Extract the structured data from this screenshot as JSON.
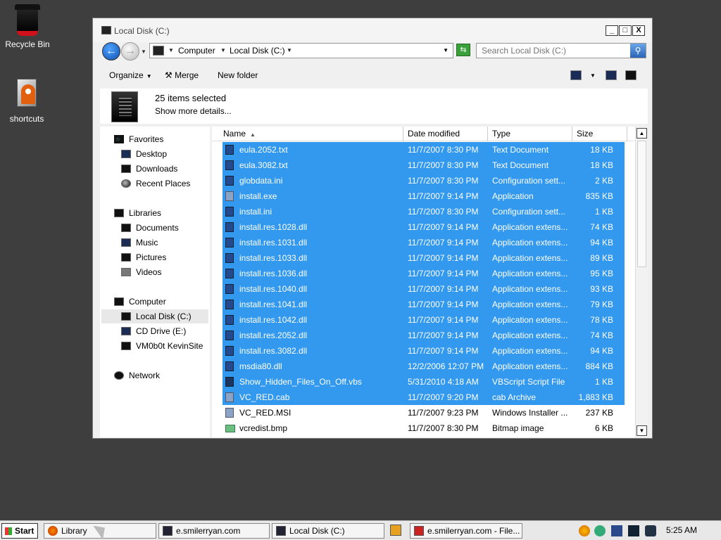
{
  "desktop": {
    "recycle_bin": "Recycle Bin",
    "shortcuts": "shortcuts"
  },
  "window": {
    "title": "Local Disk (C:)",
    "controls": {
      "minimize": "_",
      "maximize": "□",
      "close": "X"
    }
  },
  "address": {
    "crumbs": [
      "Computer",
      "Local Disk (C:)"
    ],
    "search_placeholder": "Search Local Disk (C:)"
  },
  "toolbar": {
    "organize": "Organize",
    "merge": "Merge",
    "new_folder": "New folder"
  },
  "details": {
    "count": "25 items selected",
    "more": "Show more details..."
  },
  "nav": {
    "favorites": "Favorites",
    "desktop": "Desktop",
    "downloads": "Downloads",
    "recent": "Recent Places",
    "libraries": "Libraries",
    "documents": "Documents",
    "music": "Music",
    "pictures": "Pictures",
    "videos": "Videos",
    "computer": "Computer",
    "local_disk": "Local Disk (C:)",
    "cd_drive": "CD Drive (E:)",
    "vm": "VM0b0t KevinSite",
    "network": "Network"
  },
  "columns": {
    "name": "Name",
    "date": "Date modified",
    "type": "Type",
    "size": "Size"
  },
  "files": [
    {
      "name": "eula.2052.txt",
      "date": "11/7/2007 8:30 PM",
      "type": "Text Document",
      "size": "18 KB",
      "selected": true,
      "icon": "doc"
    },
    {
      "name": "eula.3082.txt",
      "date": "11/7/2007 8:30 PM",
      "type": "Text Document",
      "size": "18 KB",
      "selected": true,
      "icon": "doc"
    },
    {
      "name": "globdata.ini",
      "date": "11/7/2007 8:30 PM",
      "type": "Configuration sett...",
      "size": "2 KB",
      "selected": true,
      "icon": "doc"
    },
    {
      "name": "install.exe",
      "date": "11/7/2007 9:14 PM",
      "type": "Application",
      "size": "835 KB",
      "selected": true,
      "icon": "exe"
    },
    {
      "name": "install.ini",
      "date": "11/7/2007 8:30 PM",
      "type": "Configuration sett...",
      "size": "1 KB",
      "selected": true,
      "icon": "doc"
    },
    {
      "name": "install.res.1028.dll",
      "date": "11/7/2007 9:14 PM",
      "type": "Application extens...",
      "size": "74 KB",
      "selected": true,
      "icon": "doc"
    },
    {
      "name": "install.res.1031.dll",
      "date": "11/7/2007 9:14 PM",
      "type": "Application extens...",
      "size": "94 KB",
      "selected": true,
      "icon": "doc"
    },
    {
      "name": "install.res.1033.dll",
      "date": "11/7/2007 9:14 PM",
      "type": "Application extens...",
      "size": "89 KB",
      "selected": true,
      "icon": "doc"
    },
    {
      "name": "install.res.1036.dll",
      "date": "11/7/2007 9:14 PM",
      "type": "Application extens...",
      "size": "95 KB",
      "selected": true,
      "icon": "doc"
    },
    {
      "name": "install.res.1040.dll",
      "date": "11/7/2007 9:14 PM",
      "type": "Application extens...",
      "size": "93 KB",
      "selected": true,
      "icon": "doc"
    },
    {
      "name": "install.res.1041.dll",
      "date": "11/7/2007 9:14 PM",
      "type": "Application extens...",
      "size": "79 KB",
      "selected": true,
      "icon": "doc"
    },
    {
      "name": "install.res.1042.dll",
      "date": "11/7/2007 9:14 PM",
      "type": "Application extens...",
      "size": "78 KB",
      "selected": true,
      "icon": "doc"
    },
    {
      "name": "install.res.2052.dll",
      "date": "11/7/2007 9:14 PM",
      "type": "Application extens...",
      "size": "74 KB",
      "selected": true,
      "icon": "doc"
    },
    {
      "name": "install.res.3082.dll",
      "date": "11/7/2007 9:14 PM",
      "type": "Application extens...",
      "size": "94 KB",
      "selected": true,
      "icon": "doc"
    },
    {
      "name": "msdia80.dll",
      "date": "12/2/2006 12:07 PM",
      "type": "Application extens...",
      "size": "884 KB",
      "selected": true,
      "icon": "doc"
    },
    {
      "name": "Show_Hidden_Files_On_Off.vbs",
      "date": "5/31/2010 4:18 AM",
      "type": "VBScript Script File",
      "size": "1 KB",
      "selected": true,
      "icon": "vbs"
    },
    {
      "name": "VC_RED.cab",
      "date": "11/7/2007 9:20 PM",
      "type": "cab Archive",
      "size": "1,883 KB",
      "selected": true,
      "icon": "exe"
    },
    {
      "name": "VC_RED.MSI",
      "date": "11/7/2007 9:23 PM",
      "type": "Windows Installer ...",
      "size": "237 KB",
      "selected": false,
      "icon": "exe"
    },
    {
      "name": "vcredist.bmp",
      "date": "11/7/2007 8:30 PM",
      "type": "Bitmap image",
      "size": "6 KB",
      "selected": false,
      "icon": "img"
    }
  ],
  "taskbar": {
    "start": "Start",
    "tasks": [
      "Library",
      "e.smilerryan.com",
      "Local Disk (C:)",
      "e.smilerryan.com - File..."
    ],
    "clock": "5:25 AM"
  }
}
